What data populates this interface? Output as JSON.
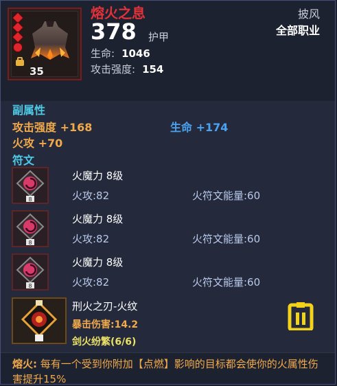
{
  "item": {
    "name": "熔火之息",
    "armor_value": "378",
    "armor_label": "护甲",
    "slot": "披风",
    "class": "全部职业",
    "level": "35",
    "stats": [
      {
        "label": "生命:",
        "value": "1046"
      },
      {
        "label": "攻击强度:",
        "value": "154"
      }
    ]
  },
  "secondary": {
    "title": "副属性",
    "items": [
      {
        "label": "攻击强度",
        "value": "+168"
      },
      {
        "label": "生命",
        "value": "+174"
      },
      {
        "label": "火攻",
        "value": "+70"
      }
    ]
  },
  "runes": {
    "title": "符文",
    "items": [
      {
        "name": "火魔力 8级",
        "stat": "火攻:82",
        "energy": "火符文能量:60",
        "gem_level": "8"
      },
      {
        "name": "火魔力 8级",
        "stat": "火攻:82",
        "energy": "火符文能量:60",
        "gem_level": "8"
      },
      {
        "name": "火魔力 8级",
        "stat": "火攻:82",
        "energy": "火符文能量:60",
        "gem_level": "8"
      }
    ],
    "set": {
      "name": "刑火之刃-火纹",
      "crit": "暴击伤害:14.2",
      "count": "剑火纷繁(6/6)"
    }
  },
  "effect": {
    "keyword": "熔火:",
    "text": "每有一个受到你附加【点燃】影响的目标都会使你的火属性伤害提升15%"
  },
  "colors": {
    "name": "#e3313a",
    "section": "#4ec9e6",
    "orange": "#f2a94a",
    "blue": "#4ba3f0",
    "yellow": "#eae066"
  },
  "icons": [
    "cloak-icon",
    "gem-icon",
    "bag-icon",
    "rune-icon",
    "set-icon",
    "clipboard-icon"
  ]
}
